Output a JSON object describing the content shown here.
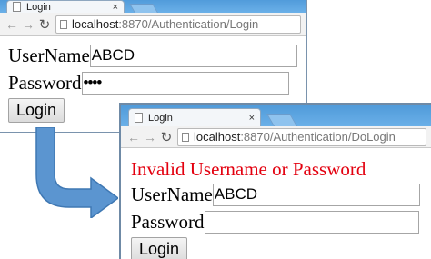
{
  "window1": {
    "tab_title": "Login",
    "tab_close": "×",
    "url_host": "localhost",
    "url_rest": ":8870/Authentication/Login",
    "username_label": "UserName",
    "username_value": "ABCD",
    "password_label": "Password",
    "password_value": "••••",
    "login_label": "Login"
  },
  "window2": {
    "tab_title": "Login",
    "tab_close": "×",
    "url_host": "localhost",
    "url_rest": ":8870/Authentication/DoLogin",
    "error_message": "Invalid Username or Password",
    "username_label": "UserName",
    "username_value": "ABCD",
    "password_label": "Password",
    "password_value": "",
    "login_label": "Login"
  },
  "icons": {
    "back": "back-arrow-icon",
    "forward": "forward-arrow-icon",
    "reload": "reload-icon",
    "page": "page-icon",
    "transition": "curved-arrow-icon"
  },
  "colors": {
    "error": "#e3000f",
    "tabstrip": "#5ca4e0",
    "arrow": "#5b95d0"
  }
}
